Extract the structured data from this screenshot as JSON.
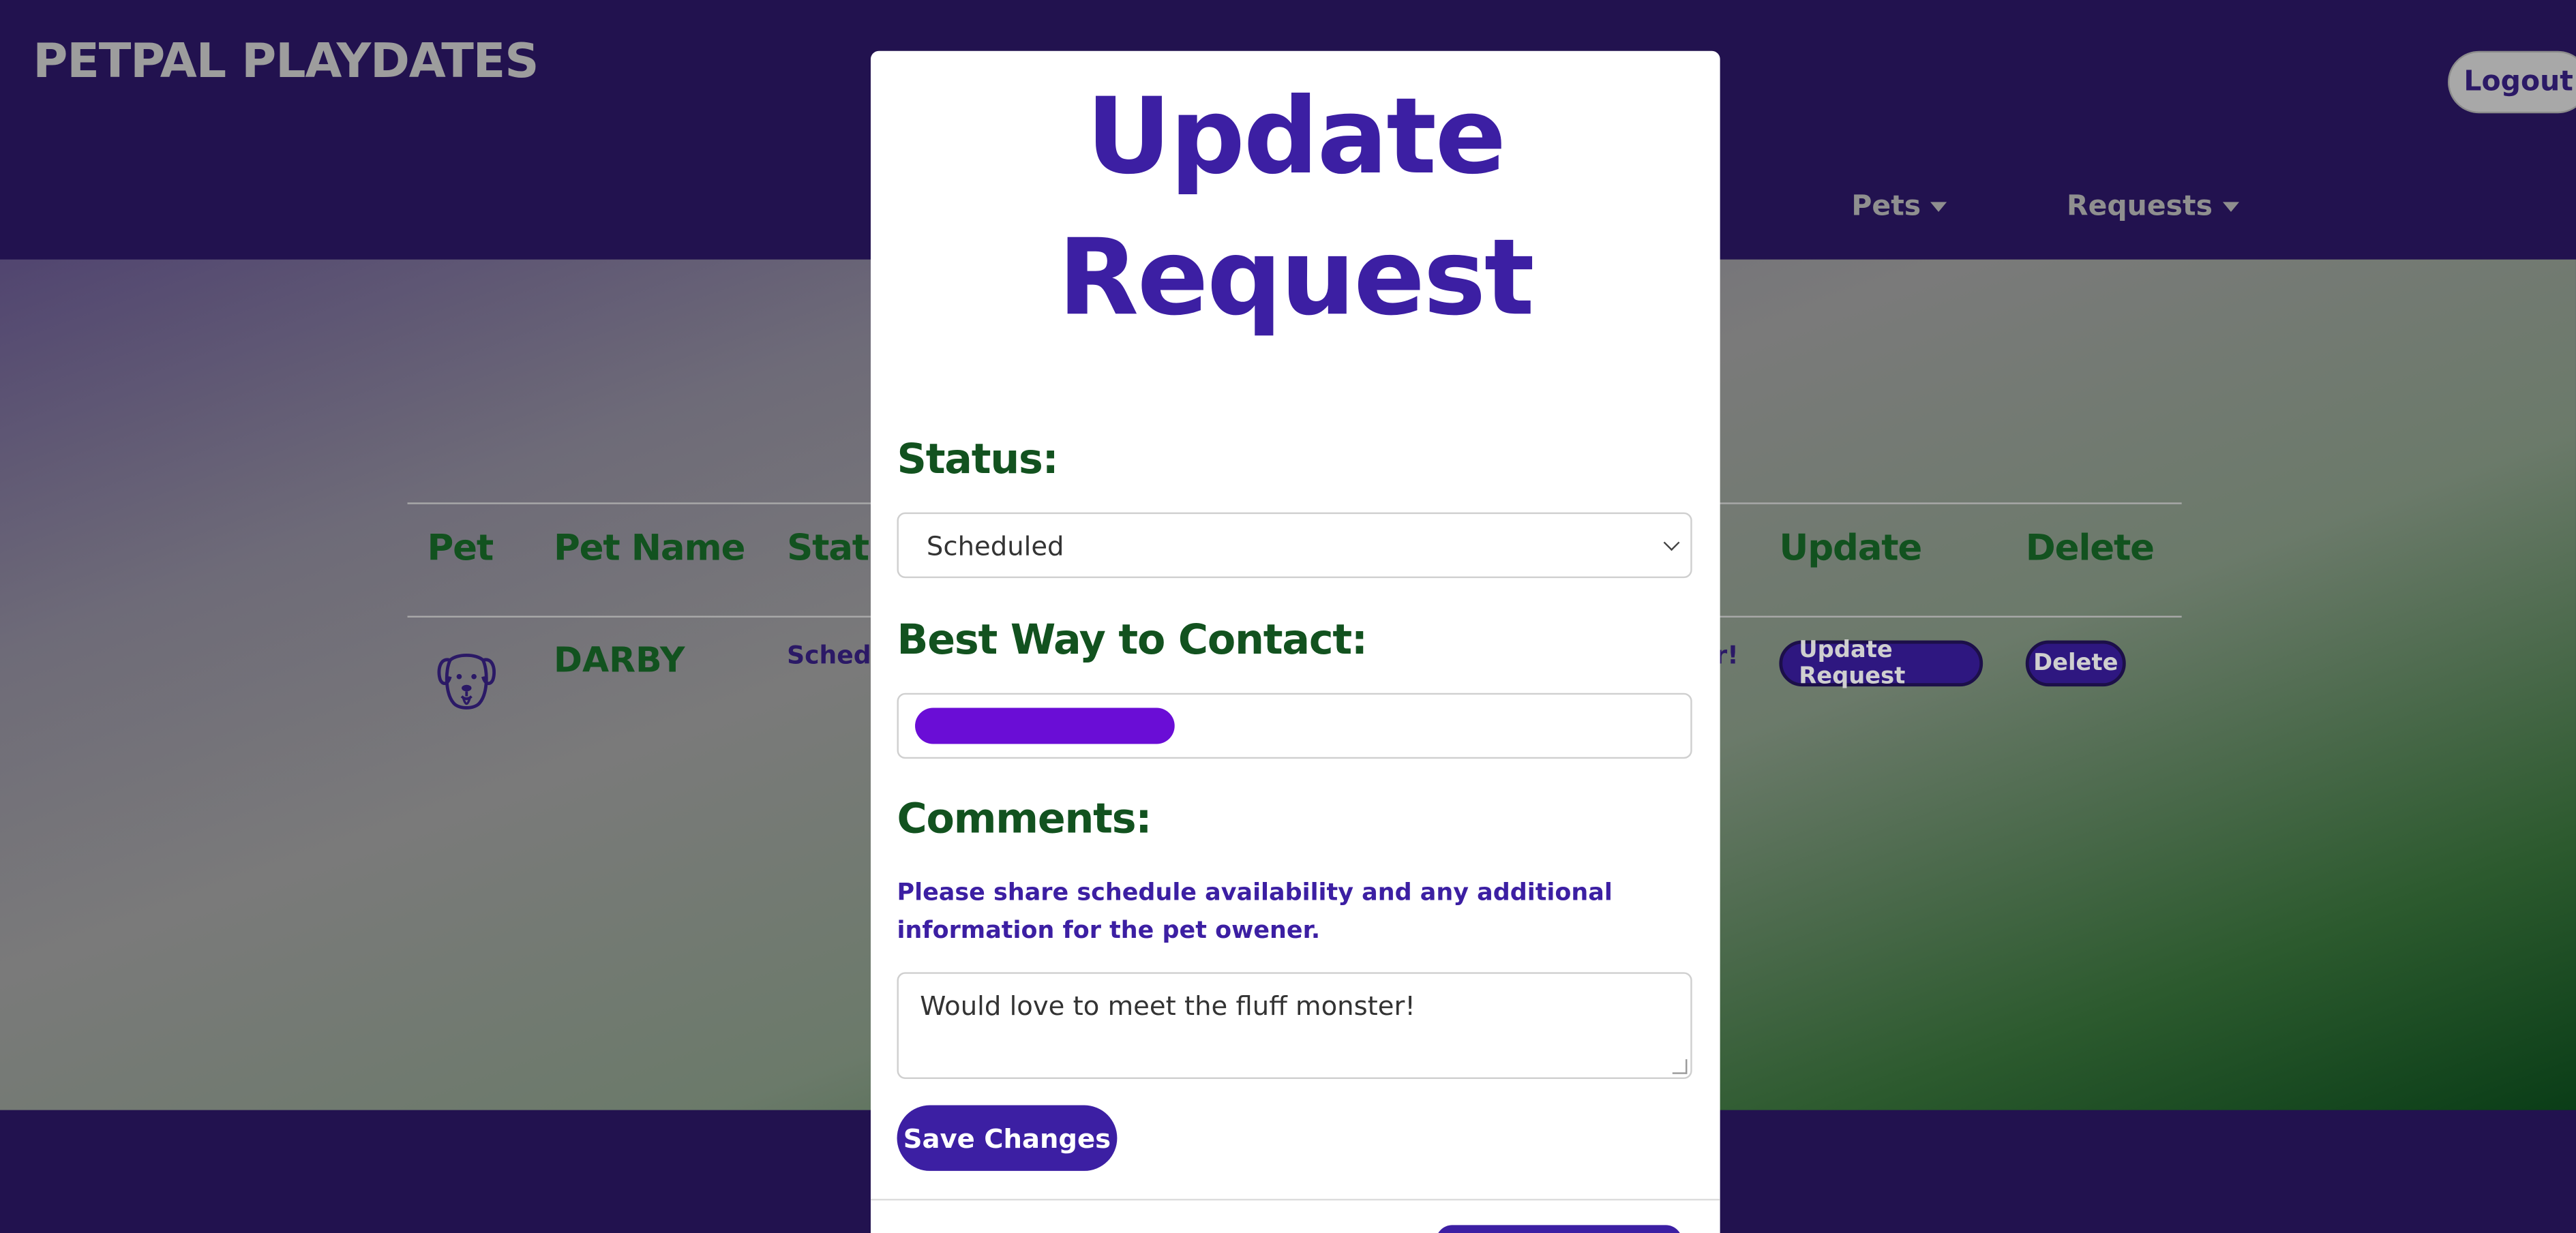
{
  "navbar": {
    "brand": "PetPal Playdates",
    "logout_label": "Logout",
    "menus": [
      {
        "label": "Pets"
      },
      {
        "label": "Requests"
      }
    ]
  },
  "table": {
    "headers": [
      "Pet",
      "Pet Name",
      "Stat",
      "Update",
      "Delete"
    ],
    "rows": [
      {
        "pet_icon": "dog-icon",
        "pet_name": "DARBY",
        "status": "Schedu",
        "trailing_text": "r!",
        "update_label": "Update Request",
        "delete_label": "Delete"
      }
    ]
  },
  "modal": {
    "title": "Update Request",
    "status_label": "Status:",
    "status_value": "Scheduled",
    "contact_label": "Best Way to Contact:",
    "comments_label": "Comments:",
    "help_text": "Please share schedule availability and any additional information for the pet owener.",
    "comments_value": "Would love to meet the fluff monster!",
    "save_label": "Save Changes"
  },
  "colors": {
    "navbar_bg": "#22124f",
    "accent_purple": "#3c1fa3",
    "label_green": "#12521f",
    "redaction": "#6a0dd6"
  }
}
